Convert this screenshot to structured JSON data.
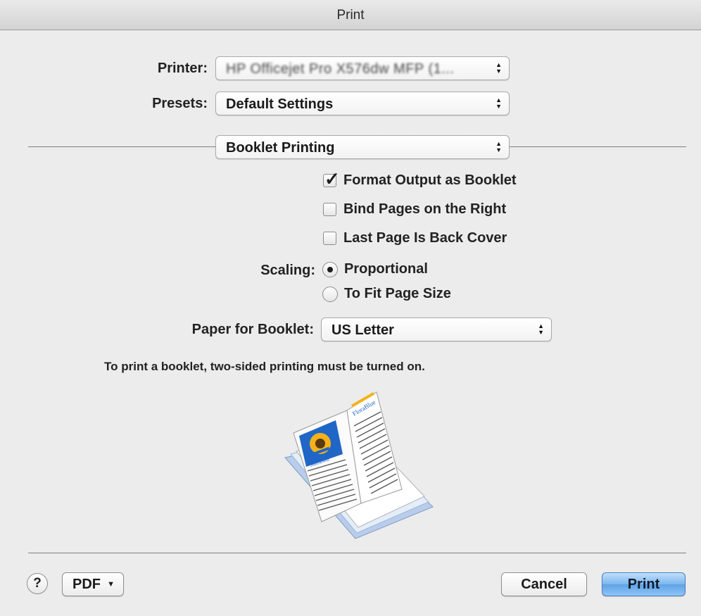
{
  "window": {
    "title": "Print"
  },
  "printer": {
    "label": "Printer:",
    "value": "HP Officejet Pro X576dw MFP (1..."
  },
  "presets": {
    "label": "Presets:",
    "value": "Default Settings"
  },
  "section": {
    "value": "Booklet Printing"
  },
  "options": {
    "format_booklet": {
      "label": "Format Output as Booklet",
      "checked": true
    },
    "bind_right": {
      "label": "Bind Pages on the Right",
      "checked": false
    },
    "last_page_back": {
      "label": "Last Page Is Back Cover",
      "checked": false
    }
  },
  "scaling": {
    "label": "Scaling:",
    "options": [
      {
        "label": "Proportional",
        "selected": true
      },
      {
        "label": "To Fit Page Size",
        "selected": false
      }
    ]
  },
  "paper": {
    "label": "Paper for Booklet:",
    "value": "US Letter"
  },
  "note": "To print a booklet, two-sided printing must be turned on.",
  "preview": {
    "icon": "booklet-preview-icon",
    "cover_title": "FloraBlue",
    "cover_caption": "Sunflower"
  },
  "footer": {
    "help_label": "?",
    "pdf_label": "PDF",
    "cancel_label": "Cancel",
    "print_label": "Print"
  },
  "colors": {
    "accent": "#6aaaf0",
    "background": "#ececec"
  }
}
